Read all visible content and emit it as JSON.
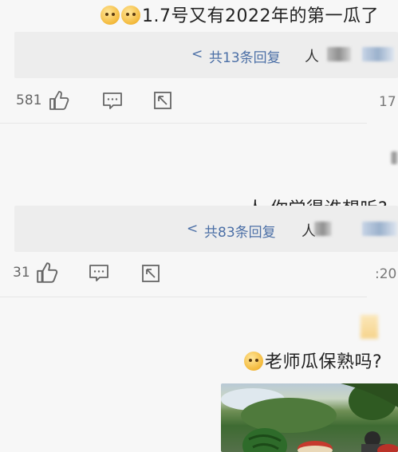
{
  "comments": [
    {
      "text": "1.7号又有2022年的第一瓜了",
      "replies_label": "共13条回复",
      "time": "17",
      "likes": "581"
    },
    {
      "text": "人 你觉得谁想听?",
      "replies_label": "共83条回复",
      "time": ":20",
      "likes": "31"
    },
    {
      "text": "老师瓜保熟吗?"
    }
  ],
  "reply_author_glyph": "人",
  "chevron": "<",
  "icons": [
    "thumbs-up-icon",
    "comment-icon",
    "share-icon",
    "chevron-icon",
    "emoji-icon"
  ],
  "colors": {
    "background": "#f7f7f7",
    "reply_bar": "#ededed",
    "link_blue": "#4b6fa6",
    "text": "#222222",
    "muted": "#666666"
  }
}
